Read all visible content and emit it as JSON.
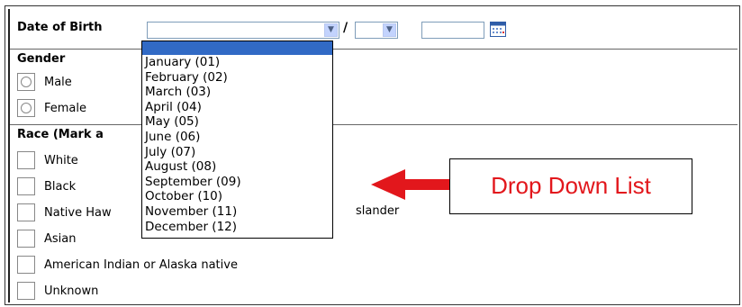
{
  "form": {
    "dob_label": "Date of Birth",
    "dob_slash": "/",
    "gender_label": "Gender",
    "gender_options": [
      "Male",
      "Female"
    ],
    "race_label": "Race (Mark a",
    "race_options": [
      "White",
      "Black",
      "Native Haw",
      "slander",
      "Asian",
      "American Indian or Alaska native",
      "Unknown"
    ]
  },
  "dropdown": {
    "months": [
      "January (01)",
      "February (02)",
      "March (03)",
      "April (04)",
      "May (05)",
      "June (06)",
      "July (07)",
      "August (08)",
      "September (09)",
      "October (10)",
      "November (11)",
      "December (12)"
    ]
  },
  "annotation": {
    "callout_text": "Drop Down List",
    "callout_color": "#e2171c"
  },
  "icons": {
    "dropdown_arrow": "chevron-down-icon",
    "calendar": "calendar-icon",
    "callout_arrow": "left-arrow-icon"
  }
}
